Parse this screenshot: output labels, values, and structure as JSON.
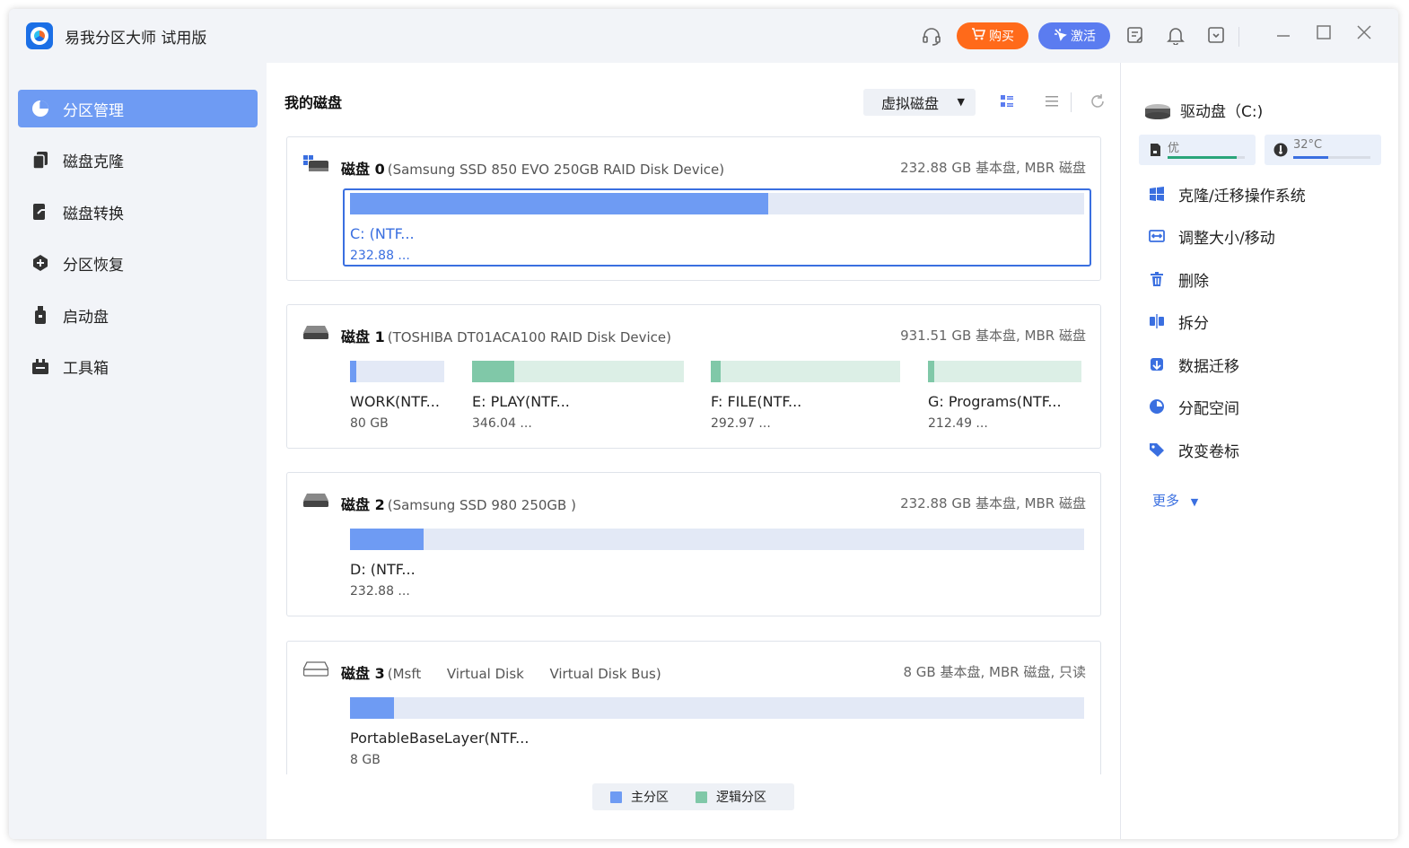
{
  "app": {
    "title": "易我分区大师 试用版"
  },
  "titlebar": {
    "buy_label": "购买",
    "activate_label": "激活"
  },
  "sidebar": {
    "items": [
      {
        "label": "分区管理",
        "active": true
      },
      {
        "label": "磁盘克隆"
      },
      {
        "label": "磁盘转换"
      },
      {
        "label": "分区恢复"
      },
      {
        "label": "启动盘"
      },
      {
        "label": "工具箱"
      }
    ]
  },
  "main": {
    "title": "我的磁盘",
    "virtual_disk_label": "虚拟磁盘",
    "disks": [
      {
        "name": "磁盘 0",
        "model": "(Samsung SSD 850 EVO 250GB RAID Disk Device)",
        "info": "232.88 GB 基本盘, MBR 磁盘",
        "partitions": [
          {
            "name": "C: (NTF...",
            "size": "232.88 ...",
            "type": "primary",
            "used": 0.57
          }
        ]
      },
      {
        "name": "磁盘 1",
        "model": "(TOSHIBA DT01ACA100 RAID Disk Device)",
        "info": "931.51 GB 基本盘, MBR 磁盘",
        "partitions": [
          {
            "name": "WORK(NTF...",
            "size": "80 GB",
            "type": "primary",
            "used": 0.07
          },
          {
            "name": "E: PLAY(NTF...",
            "size": "346.04 ...",
            "type": "logical",
            "used": 0.2
          },
          {
            "name": "F: FILE(NTF...",
            "size": "292.97 ...",
            "type": "logical",
            "used": 0.05
          },
          {
            "name": "G: Programs(NTF...",
            "size": "212.49 ...",
            "type": "logical",
            "used": 0.04
          }
        ]
      },
      {
        "name": "磁盘 2",
        "model": "(Samsung SSD 980 250GB )",
        "info": "232.88 GB 基本盘, MBR 磁盘",
        "partitions": [
          {
            "name": "D: (NTF...",
            "size": "232.88 ...",
            "type": "primary",
            "used": 0.1
          }
        ]
      },
      {
        "name": "磁盘 3",
        "model": "(Msft      Virtual Disk      Virtual Disk Bus)",
        "info": "8 GB 基本盘, MBR 磁盘, 只读",
        "partitions": [
          {
            "name": "PortableBaseLayer(NTF...",
            "size": "8 GB",
            "type": "primary",
            "used": 0.06
          }
        ]
      }
    ],
    "legend": {
      "primary": "主分区",
      "logical": "逻辑分区"
    }
  },
  "right_panel": {
    "drive_label": "驱动盘（C:)",
    "health_label": "优",
    "health_level": 0.9,
    "temp_label": "32°C",
    "temp_level": 0.45,
    "operations": [
      "克隆/迁移操作系统",
      "调整大小/移动",
      "删除",
      "拆分",
      "数据迁移",
      "分配空间",
      "改变卷标"
    ],
    "more_label": "更多"
  },
  "colors": {
    "primary": "#6e9bf3",
    "logical": "#80c8a8",
    "accent": "#3a6fe0",
    "buy": "#ff6a1a",
    "activate": "#5b7cf0"
  }
}
